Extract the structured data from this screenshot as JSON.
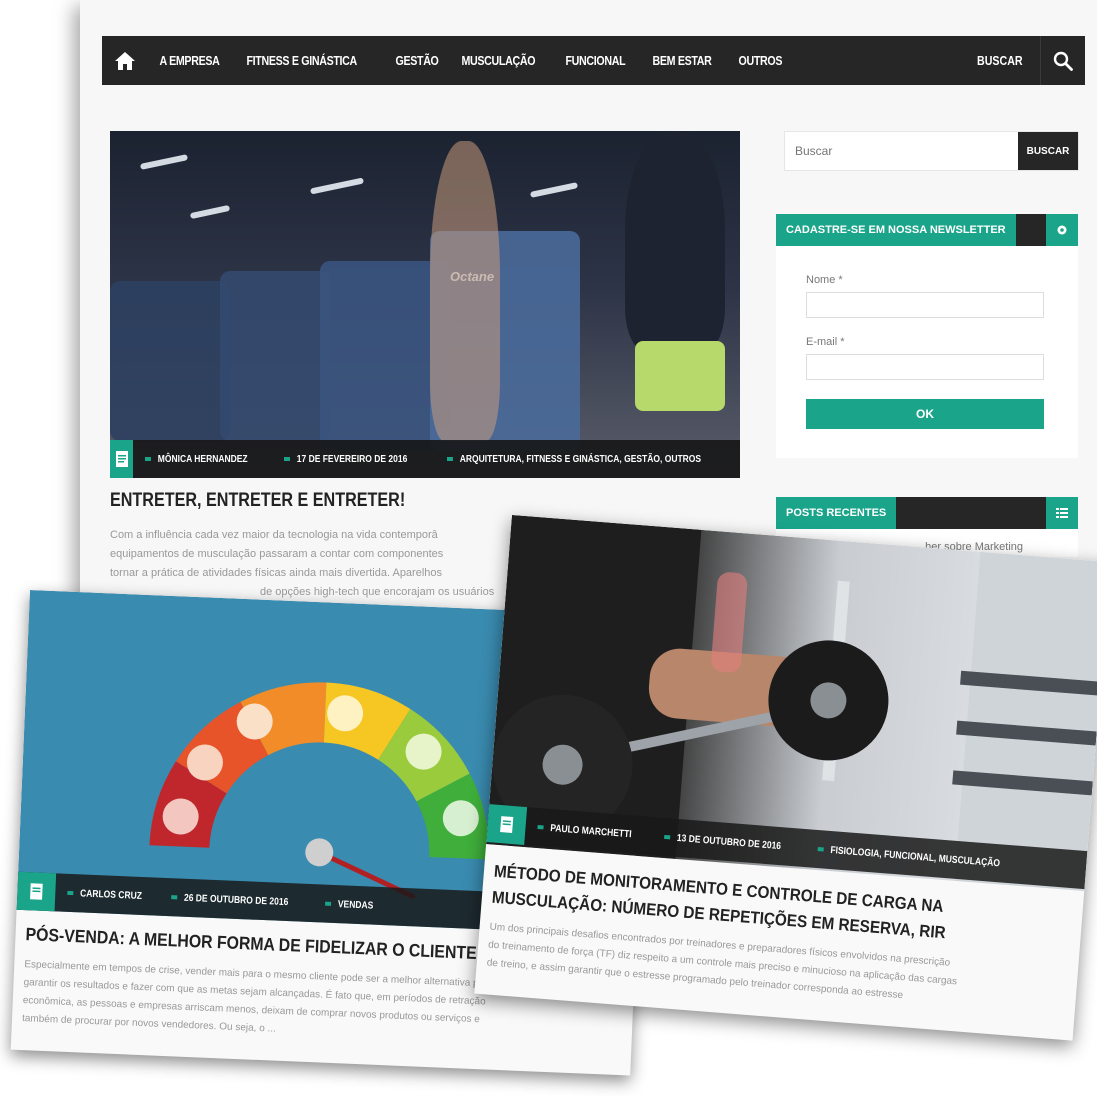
{
  "nav": {
    "items": [
      "A EMPRESA",
      "FITNESS E GINÁSTICA",
      "GESTÃO",
      "MUSCULAÇÃO",
      "FUNCIONAL",
      "BEM ESTAR",
      "OUTROS"
    ],
    "search_label": "BUSCAR"
  },
  "main_post": {
    "author": "MÔNICA HERNANDEZ",
    "date": "17 DE FEVEREIRO DE 2016",
    "categories": "ARQUITETURA, FITNESS E GINÁSTICA, GESTÃO, OUTROS",
    "title": "ENTRETER, ENTRETER E ENTRETER!",
    "excerpt_lines": [
      "Com a influência cada vez maior da tecnologia na vida contemporâ",
      "equipamentos de musculação passaram a contar com componentes",
      "tornar a prática de atividades físicas ainda mais divertida. Aparelhos",
      "de opções high-tech que encorajam os usuários"
    ],
    "machine_brand": "Octane"
  },
  "sidebar": {
    "search_placeholder": "Buscar",
    "search_button": "BUSCAR",
    "newsletter": {
      "title": "CADASTRE-SE EM NOSSA NEWSLETTER",
      "name_label": "Nome *",
      "email_label": "E-mail *",
      "submit": "OK"
    },
    "recent": {
      "title": "POSTS RECENTES",
      "first_item": "...her sobre Marketing"
    }
  },
  "card_left": {
    "author": "CARLOS CRUZ",
    "date": "26 DE OUTUBRO DE 2016",
    "category": "VENDAS",
    "title": "PÓS-VENDA: A MELHOR FORMA DE FIDELIZAR O CLIENTE",
    "excerpt_lines": [
      "Especialmente em tempos de crise, vender mais para o mesmo cliente pode ser a melhor alternativa para",
      "garantir os resultados e fazer com que as metas sejam alcançadas. É fato que, em períodos de retração",
      "econômica, as pessoas e empresas arriscam menos, deixam de comprar novos produtos ou serviços e",
      "também de procurar por novos vendedores. Ou seja, o ..."
    ]
  },
  "card_right": {
    "author": "PAULO MARCHETTI",
    "date": "13 DE OUTUBRO DE 2016",
    "categories": "FISIOLOGIA, FUNCIONAL, MUSCULAÇÃO",
    "title": "MÉTODO DE MONITORAMENTO E CONTROLE DE CARGA NA MUSCULAÇÃO: NÚMERO DE REPETIÇÕES EM RESERVA, RIR",
    "excerpt_lines": [
      "Um dos principais desafios encontrados por treinadores e preparadores físicos envolvidos na prescrição",
      "do treinamento de força (TF) diz respeito a um controle mais preciso e minucioso na aplicação das cargas",
      "de treino, e assim garantir que o estresse programado pelo treinador corresponda ao estresse"
    ]
  },
  "colors": {
    "accent": "#1aa58a",
    "dark": "#262626",
    "page_bg": "#f7f7f7"
  },
  "icons": [
    "home-icon",
    "search-icon",
    "document-icon",
    "gear-icon",
    "list-icon"
  ]
}
